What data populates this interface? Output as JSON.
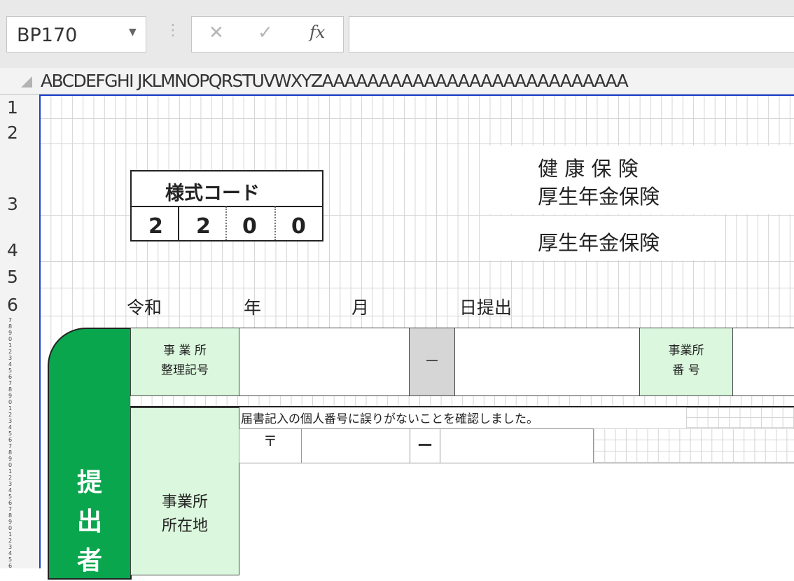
{
  "formula_bar": {
    "name_box": "BP170",
    "cancel_icon": "✕",
    "enter_icon": "✓",
    "fx_label": "fx",
    "formula": ""
  },
  "column_headers": "ABCDEFGHI JKLMNOPQRSTUVWXYZAAAAAAAAAAAAAAAAAAAAAAAAAAA",
  "row_headers": [
    "1",
    "2",
    "3",
    "4",
    "5",
    "6"
  ],
  "form": {
    "insurance_line1": "健 康 保 険",
    "insurance_line2": "厚生年金保険",
    "insurance_line3": "厚生年金保険",
    "form_code_label": "様式コード",
    "form_code_digits": [
      "2",
      "2",
      "0",
      "0"
    ],
    "date_era": "令和",
    "date_year": "年",
    "date_month": "月",
    "date_day": "日提出",
    "office_ref_label_1": "事 業 所",
    "office_ref_label_2": "整理記号",
    "dash": "－",
    "office_no_label_1": "事業所",
    "office_no_label_2": "番 号",
    "confirm_text": "届書記入の個人番号に誤りがないことを確認しました。",
    "postal_mark": "〒",
    "postal_dash": "ー",
    "address_label_1": "事業所",
    "address_label_2": "所在地",
    "submitter_label": "提出者"
  },
  "colors": {
    "green_panel": "#0aa64e",
    "light_green": "#dbf7dd",
    "selection_blue": "#1a3fd0"
  }
}
